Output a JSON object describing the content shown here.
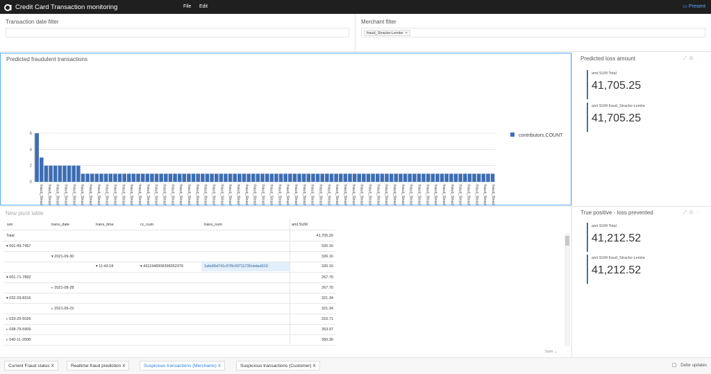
{
  "app": {
    "title": "Credit Card Transaction monitoring",
    "menu": [
      "File",
      "Edit"
    ],
    "present_label": "Present"
  },
  "filters": {
    "date": {
      "label": "Transaction date filter"
    },
    "merchant": {
      "label": "Merchant filter",
      "chip": "fraud_Stracke-Lemke"
    }
  },
  "chart_panel": {
    "title": "Predicted fraudulent transactions",
    "chart_data": {
      "type": "bar",
      "legend": "contributors.COUNT",
      "legend_position": "top-right",
      "ylim": [
        0,
        6
      ],
      "yticks": [
        "0",
        "2",
        "4",
        "6"
      ],
      "grid": true,
      "values": [
        6,
        3,
        2,
        2,
        2,
        2,
        2,
        2,
        2,
        2,
        1,
        1,
        1,
        1,
        1,
        1,
        1,
        1,
        1,
        1,
        1,
        1,
        1,
        1,
        1,
        1,
        1,
        1,
        1,
        1,
        1,
        1,
        1,
        1,
        1,
        1,
        1,
        1,
        1,
        1,
        1,
        1,
        1,
        1,
        1,
        1,
        1,
        1,
        1,
        1,
        1,
        1,
        1,
        1,
        1,
        1,
        1,
        1,
        1,
        1,
        1,
        1,
        1,
        1,
        1,
        1,
        1,
        1,
        1,
        1,
        1,
        1,
        1,
        1,
        1,
        1,
        1,
        1,
        1,
        1,
        1,
        1,
        1,
        1,
        1,
        1,
        1,
        1,
        1,
        1,
        1,
        1,
        1,
        1,
        1,
        1,
        1,
        1,
        1,
        1
      ],
      "categories": [
        "fraud_Stracke-Lemke, 94087",
        "fraud_Stracke-Lemke, 80230",
        "fraud_Stracke-Lemke, 81947",
        "fraud_Stracke-Lemke, 295761",
        "fraud_Stracke-Lemke, 346236",
        "fraud_Stracke-Lemke, 261135",
        "fraud_Stracke-Lemke, 363176",
        "fraud_Stracke-Lemke, 348065",
        "fraud_Stracke-Lemke, 120823",
        "fraud_Stracke-Lemke, 168690",
        "fraud_Stracke-Lemke, 663423",
        "fraud_Stracke-Lemke, 519745",
        "fraud_Stracke-Lemke, 681131",
        "fraud_Stracke-Lemke, 145408",
        "fraud_Stracke-Lemke, 70098",
        "fraud_Stracke-Lemke, 344628",
        "fraud_Stracke-Lemke, 92961",
        "fraud_Stracke-Lemke, 825010",
        "fraud_Stracke-Lemke, 661337",
        "fraud_Stracke-Lemke, 105725",
        "fraud_Stracke-Lemke, 453973",
        "fraud_Stracke-Lemke, 134995",
        "fraud_Stracke-Lemke, 846367",
        "fraud_Stracke-Lemke, 94819",
        "fraud_Stracke-Lemke, 121205",
        "fraud_Stracke-Lemke, 256749",
        "fraud_Stracke-Lemke, 512726",
        "fraud_Stracke-Lemke, 399816",
        "fraud_Stracke-Lemke, 195576",
        "fraud_Stracke-Lemke, 349176",
        "fraud_Stracke-Lemke, 175862",
        "fraud_Stracke-Lemke, 10495",
        "fraud_Stracke-Lemke, 184244",
        "fraud_Stracke-Lemke, 189815",
        "fraud_Stracke-Lemke, 308603",
        "fraud_Stracke-Lemke, 404775",
        "fraud_Stracke-Lemke, 994772",
        "fraud_Stracke-Lemke, 668074",
        "fraud_Stracke-Lemke, 108357",
        "fraud_Stracke-Lemke, 291660",
        "fraud_Stracke-Lemke, 412351",
        "fraud_Stracke-Lemke, 112331",
        "fraud_Stracke-Lemke, 387774",
        "fraud_Stracke-Lemke, 485145",
        "fraud_Stracke-Lemke, 1055698",
        "fraud_Stracke-Lemke, 840681",
        "fraud_Stracke-Lemke, 58383",
        "fraud_Stracke-Lemke, 369581",
        "fraud_Stracke-Lemke, 241954",
        "fraud_Stracke-Lemke, 430889",
        "fraud_Stracke-Lemke, 1619",
        "fraud_Stracke-Lemke, 71748",
        "fraud_Stracke-Lemke, 52790",
        "fraud_Stracke-Lemke, 427012",
        "fraud_Stracke-Lemke, 551439",
        "fraud_Stracke-Lemke, 1001498"
      ]
    }
  },
  "predicted_loss": {
    "title": "Predicted loss amount",
    "kpis": [
      {
        "label": "amt.SUM Total",
        "value": "41,705.25"
      },
      {
        "label": "amt.SUM fraud_Stracke-Lemke",
        "value": "41,705.25"
      }
    ]
  },
  "true_positive": {
    "title": "True positive - loss prevented",
    "kpis": [
      {
        "label": "amt.SUM Total",
        "value": "41,212.52"
      },
      {
        "label": "amt.SUM fraud_Stracke-Lemke",
        "value": "41,212.52"
      }
    ]
  },
  "pivot": {
    "title": "New pivot table",
    "headers": [
      "ssn",
      "trans_date",
      "trans_time",
      "cc_num",
      "trans_num",
      "amt.SUM"
    ],
    "total_label": "Total",
    "total_value": "41,705.25",
    "rows": [
      {
        "ssn": "001-49-7457",
        "value": "326.16"
      },
      {
        "date": "2021-09-30",
        "value": "326.16"
      },
      {
        "time": "11:43:18",
        "cc": "4311948308398352376",
        "trans": "1afa68d741c97ffc09711730cbdad319",
        "value": "326.16"
      },
      {
        "ssn": "001-71-7892",
        "value": "267.70"
      },
      {
        "date": "2021-08-28",
        "value": "267.70"
      },
      {
        "ssn": "032-29-8316",
        "value": "321.34"
      },
      {
        "date": "2021-09-22",
        "value": "321.34"
      },
      {
        "ssn": "033-20-5026",
        "value": "310.71"
      },
      {
        "ssn": "038-79-5909",
        "value": "353.97"
      },
      {
        "ssn": "040-11-2008",
        "value": "350.30"
      }
    ],
    "aggregate": "Sum"
  },
  "tabs": [
    "Current Fraud status",
    "Realtime fraud prediction",
    "Suspicious transactions (Merchants)",
    "Suspicious transactions (Customer)"
  ],
  "active_tab": 2,
  "defer_label": "Defer updates",
  "colors": {
    "bar": "#3d6eb4",
    "accent": "#5aa9ff",
    "topbar": "#1f1f1f"
  }
}
